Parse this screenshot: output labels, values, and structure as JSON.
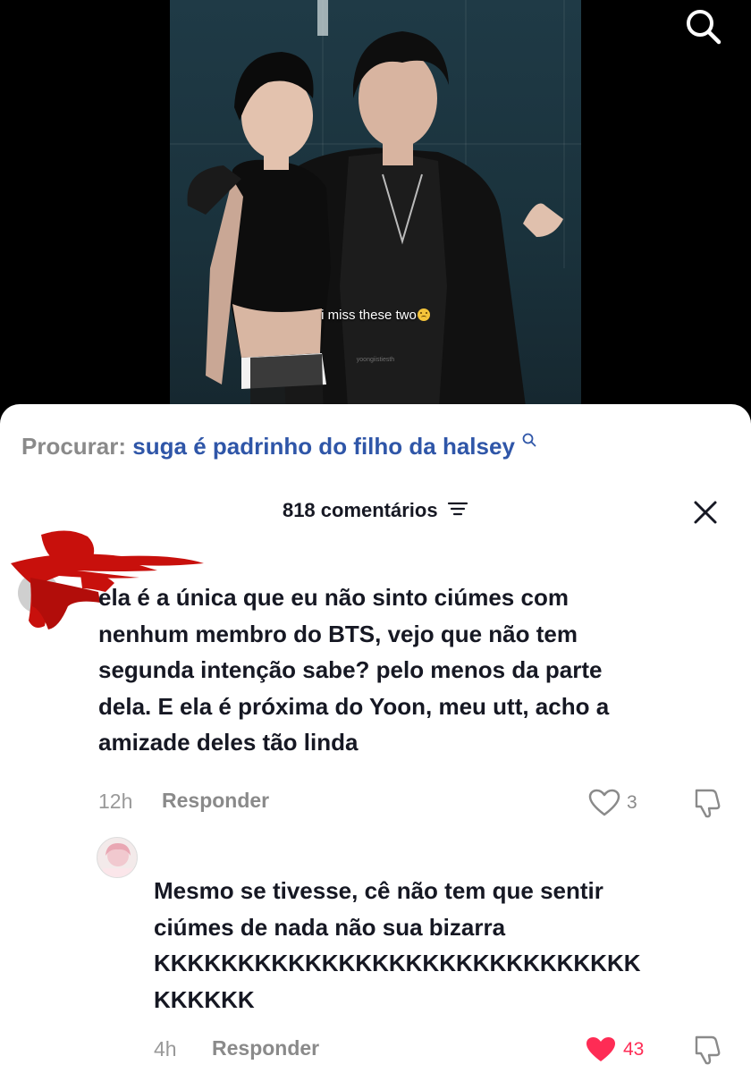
{
  "video": {
    "caption": "i miss these two",
    "caption_emoji": "worried-face-icon",
    "watermark": "yoongiistiesth"
  },
  "search_bar": {
    "prefix": "Procurar:",
    "query": "suga é padrinho do filho da halsey"
  },
  "comments_panel": {
    "count_label": "818 comentários",
    "comments": [
      {
        "text": "ela é a única que eu não sinto ciúmes com nenhum membro do BTS, vejo que não tem segunda intenção sabe? pelo menos da parte dela. E ela é próxima do Yoon, meu utt, acho a amizade deles tão linda",
        "lines": [
          "ela é a única que eu não sinto ciúmes com",
          "nenhum membro do BTS, vejo que não tem",
          "segunda intenção sabe? pelo menos da parte",
          "dela. E ela é próxima do Yoon, meu utt, acho a",
          "amizade deles tão linda"
        ],
        "time": "12h",
        "reply_label": "Responder",
        "likes": "3",
        "liked": false
      },
      {
        "text": "Mesmo se tivesse, cê não tem que sentir ciúmes de nada não sua bizarra KKKKKKKKKKKKKKKKKKKKKKKKKKKKKKKKKKK",
        "lines": [
          "Mesmo se tivesse, cê não tem que sentir",
          "ciúmes de nada não sua bizarra",
          "KKKKKKKKKKKKKKKKKKKKKKKKKKKKK",
          "KKKKKK"
        ],
        "time": "4h",
        "reply_label": "Responder",
        "likes": "43",
        "liked": true
      }
    ]
  },
  "colors": {
    "search_query": "#2f56a8",
    "like_active": "#fe2c55",
    "redaction": "#c8100c"
  }
}
